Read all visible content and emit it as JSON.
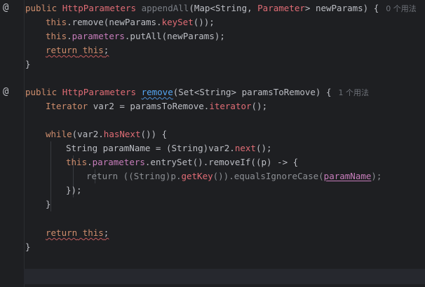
{
  "gutter": {
    "annotation_symbol": "@"
  },
  "code": {
    "l1": {
      "kw_public": "public",
      "ret_type": "HttpParameters",
      "method": "appendAll",
      "open_paren": "(",
      "p_type1": "Map<String, ",
      "p_type2": "Parameter",
      "p_type3": "> newParams) {",
      "hint": "0 个用法"
    },
    "l2": {
      "kw": "this",
      "rest1": ".remove(newParams.",
      "call": "keySet",
      "rest2": "());"
    },
    "l3": {
      "kw": "this",
      "dot": ".",
      "fld": "parameters",
      "rest": ".putAll(newParams);"
    },
    "l4": {
      "kw": "return",
      "sp": " ",
      "kw2": "this",
      "semi": ";"
    },
    "l5": {
      "brace": "}"
    },
    "l7": {
      "kw_public": "public",
      "ret_type": "HttpParameters",
      "method": "remove",
      "open_paren": "(",
      "params": "Set<String> paramsToRemove) {",
      "hint": "1 个用法"
    },
    "l8": {
      "type": "Iterator",
      "rest1": " var2 = paramsToRemove.",
      "call": "iterator",
      "rest2": "();"
    },
    "l10": {
      "kw": "while",
      "rest1": "(var2.",
      "call": "hasNext",
      "rest2": "()) {"
    },
    "l11": {
      "text1": "String paramName = (String)var2.",
      "call": "next",
      "rest": "();"
    },
    "l12": {
      "kw": "this",
      "dot": ".",
      "fld": "parameters",
      "rest": ".entrySet().removeIf((p) -> {"
    },
    "l13": {
      "kw": "return",
      "rest1": " ((String)p.",
      "call": "getKey",
      "rest2": "()).equalsIgnoreCase(",
      "param": "paramName",
      "rest3": ");"
    },
    "l14": {
      "text": "});"
    },
    "l15": {
      "brace": "}"
    },
    "l17": {
      "kw": "return",
      "sp": " ",
      "kw2": "this",
      "semi": ";"
    },
    "l18": {
      "brace": "}"
    }
  }
}
